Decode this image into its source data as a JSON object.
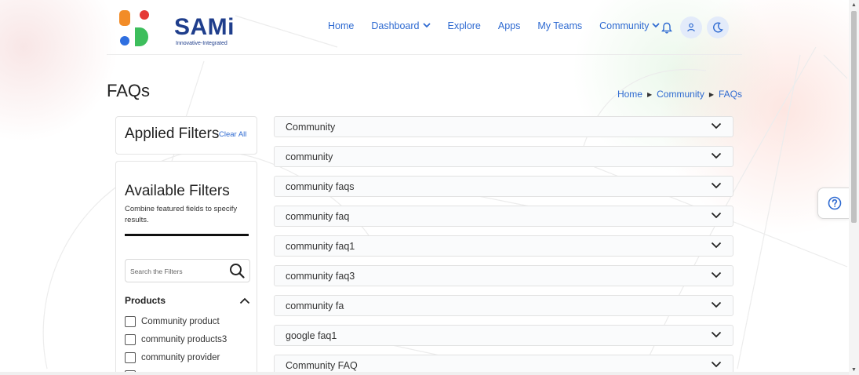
{
  "brand": {
    "name": "SAMi",
    "tagline": "Innovative-Integrated",
    "colors": {
      "orange": "#F28C28",
      "red": "#E53935",
      "blue": "#2F6FE0",
      "green": "#3DBE5C",
      "navy": "#1F3E8C"
    }
  },
  "nav": {
    "items": [
      "Home",
      "Dashboard",
      "Explore",
      "Apps",
      "My Teams",
      "Community"
    ],
    "icons": [
      "bell-icon",
      "user-icon",
      "moon-icon"
    ]
  },
  "page": {
    "title": "FAQs",
    "breadcrumb": [
      "Home",
      "Community",
      "FAQs"
    ]
  },
  "filters": {
    "applied_title": "Applied Filters",
    "clear_all": "Clear All",
    "available_title": "Available Filters",
    "available_desc": "Combine featured fields to specify results.",
    "search_placeholder": "Search the Filters",
    "group": {
      "label": "Products",
      "options": [
        "Community product",
        "community products3",
        "community provider"
      ]
    }
  },
  "faqs": [
    "Community",
    "community",
    "community faqs",
    "community faq",
    "community faq1",
    "community faq3",
    "community fa",
    "google faq1",
    "Community FAQ"
  ],
  "accent": "#2E6AD1"
}
